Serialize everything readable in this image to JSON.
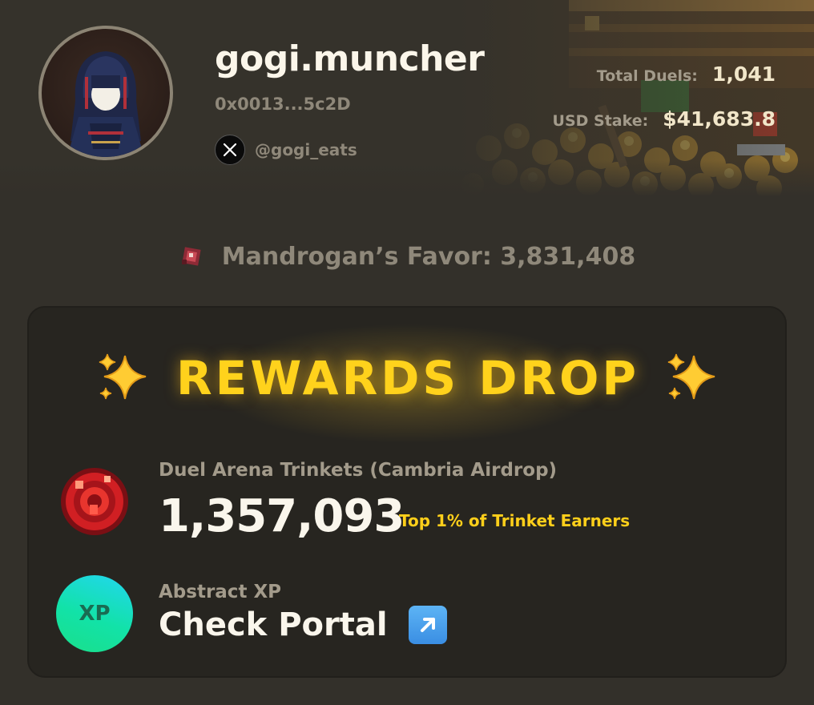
{
  "profile": {
    "username": "gogi.muncher",
    "wallet": "0x0013...5c2D",
    "x_handle": "@gogi_eats",
    "avatar": "hooded-figure-avatar"
  },
  "stats": {
    "total_duels_label": "Total Duels:",
    "total_duels_value": "1,041",
    "usd_stake_label": "USD Stake:",
    "usd_stake_value": "$41,683.8"
  },
  "favor": {
    "text": "Mandrogan’s Favor: 3,831,408",
    "icon": "favor-gem-icon"
  },
  "rewards": {
    "title": "REWARDS DROP",
    "title_icon": "sparkles-icon",
    "items": [
      {
        "label": "Duel Arena Trinkets (Cambria Airdrop)",
        "value": "1,357,093",
        "badge": "Top 1% of Trinket Earners",
        "icon": "trinket-coin-icon"
      },
      {
        "label": "Abstract XP",
        "value": "Check Portal",
        "icon": "xp-badge-icon",
        "icon_text": "XP",
        "link_icon": "external-arrow-icon"
      }
    ]
  },
  "colors": {
    "background": "#33302a",
    "card": "#272520",
    "accent_gold": "#ffd21c",
    "muted_text": "#8f887a",
    "xp_gradient_start": "#22d6f0",
    "xp_gradient_end": "#1adf8a"
  }
}
